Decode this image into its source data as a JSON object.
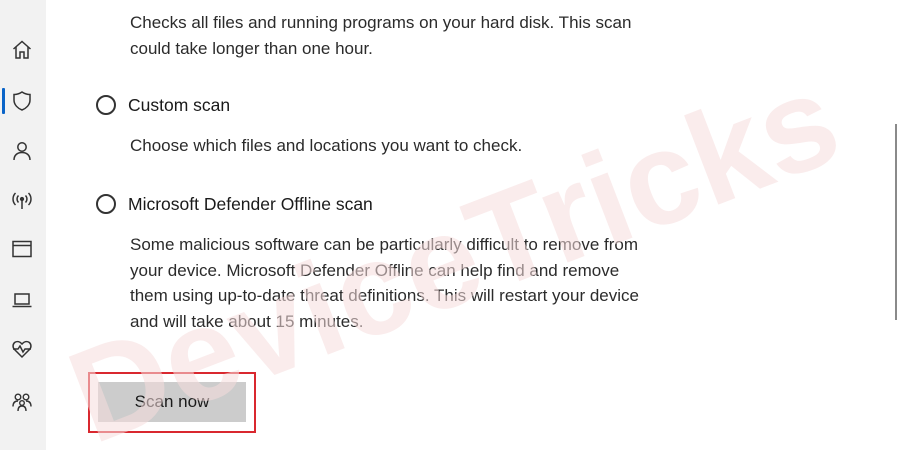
{
  "sidebar": {
    "items": [
      {
        "icon": "home-icon"
      },
      {
        "icon": "shield-icon",
        "active": true
      },
      {
        "icon": "person-icon"
      },
      {
        "icon": "wireless-icon"
      },
      {
        "icon": "window-icon"
      },
      {
        "icon": "laptop-icon"
      },
      {
        "icon": "heart-pulse-icon"
      },
      {
        "icon": "family-icon"
      }
    ],
    "accent": "#0a64c8"
  },
  "main": {
    "full_scan_description": [
      "Checks all files and running programs on your hard disk. This scan",
      "could take longer than one hour."
    ],
    "custom_scan": {
      "label": "Custom scan",
      "description": [
        "Choose which files and locations you want to check."
      ]
    },
    "offline_scan": {
      "label": "Microsoft Defender Offline scan",
      "description": [
        "Some malicious software can be particularly difficult to remove from",
        "your device. Microsoft Defender Offline can help find and remove",
        "them using up-to-date threat definitions. This will restart your device",
        "and will take about 15 minutes."
      ]
    },
    "scan_button_label": "Scan now",
    "highlight_color": "#d9282f"
  },
  "watermark": "DeviceTricks"
}
